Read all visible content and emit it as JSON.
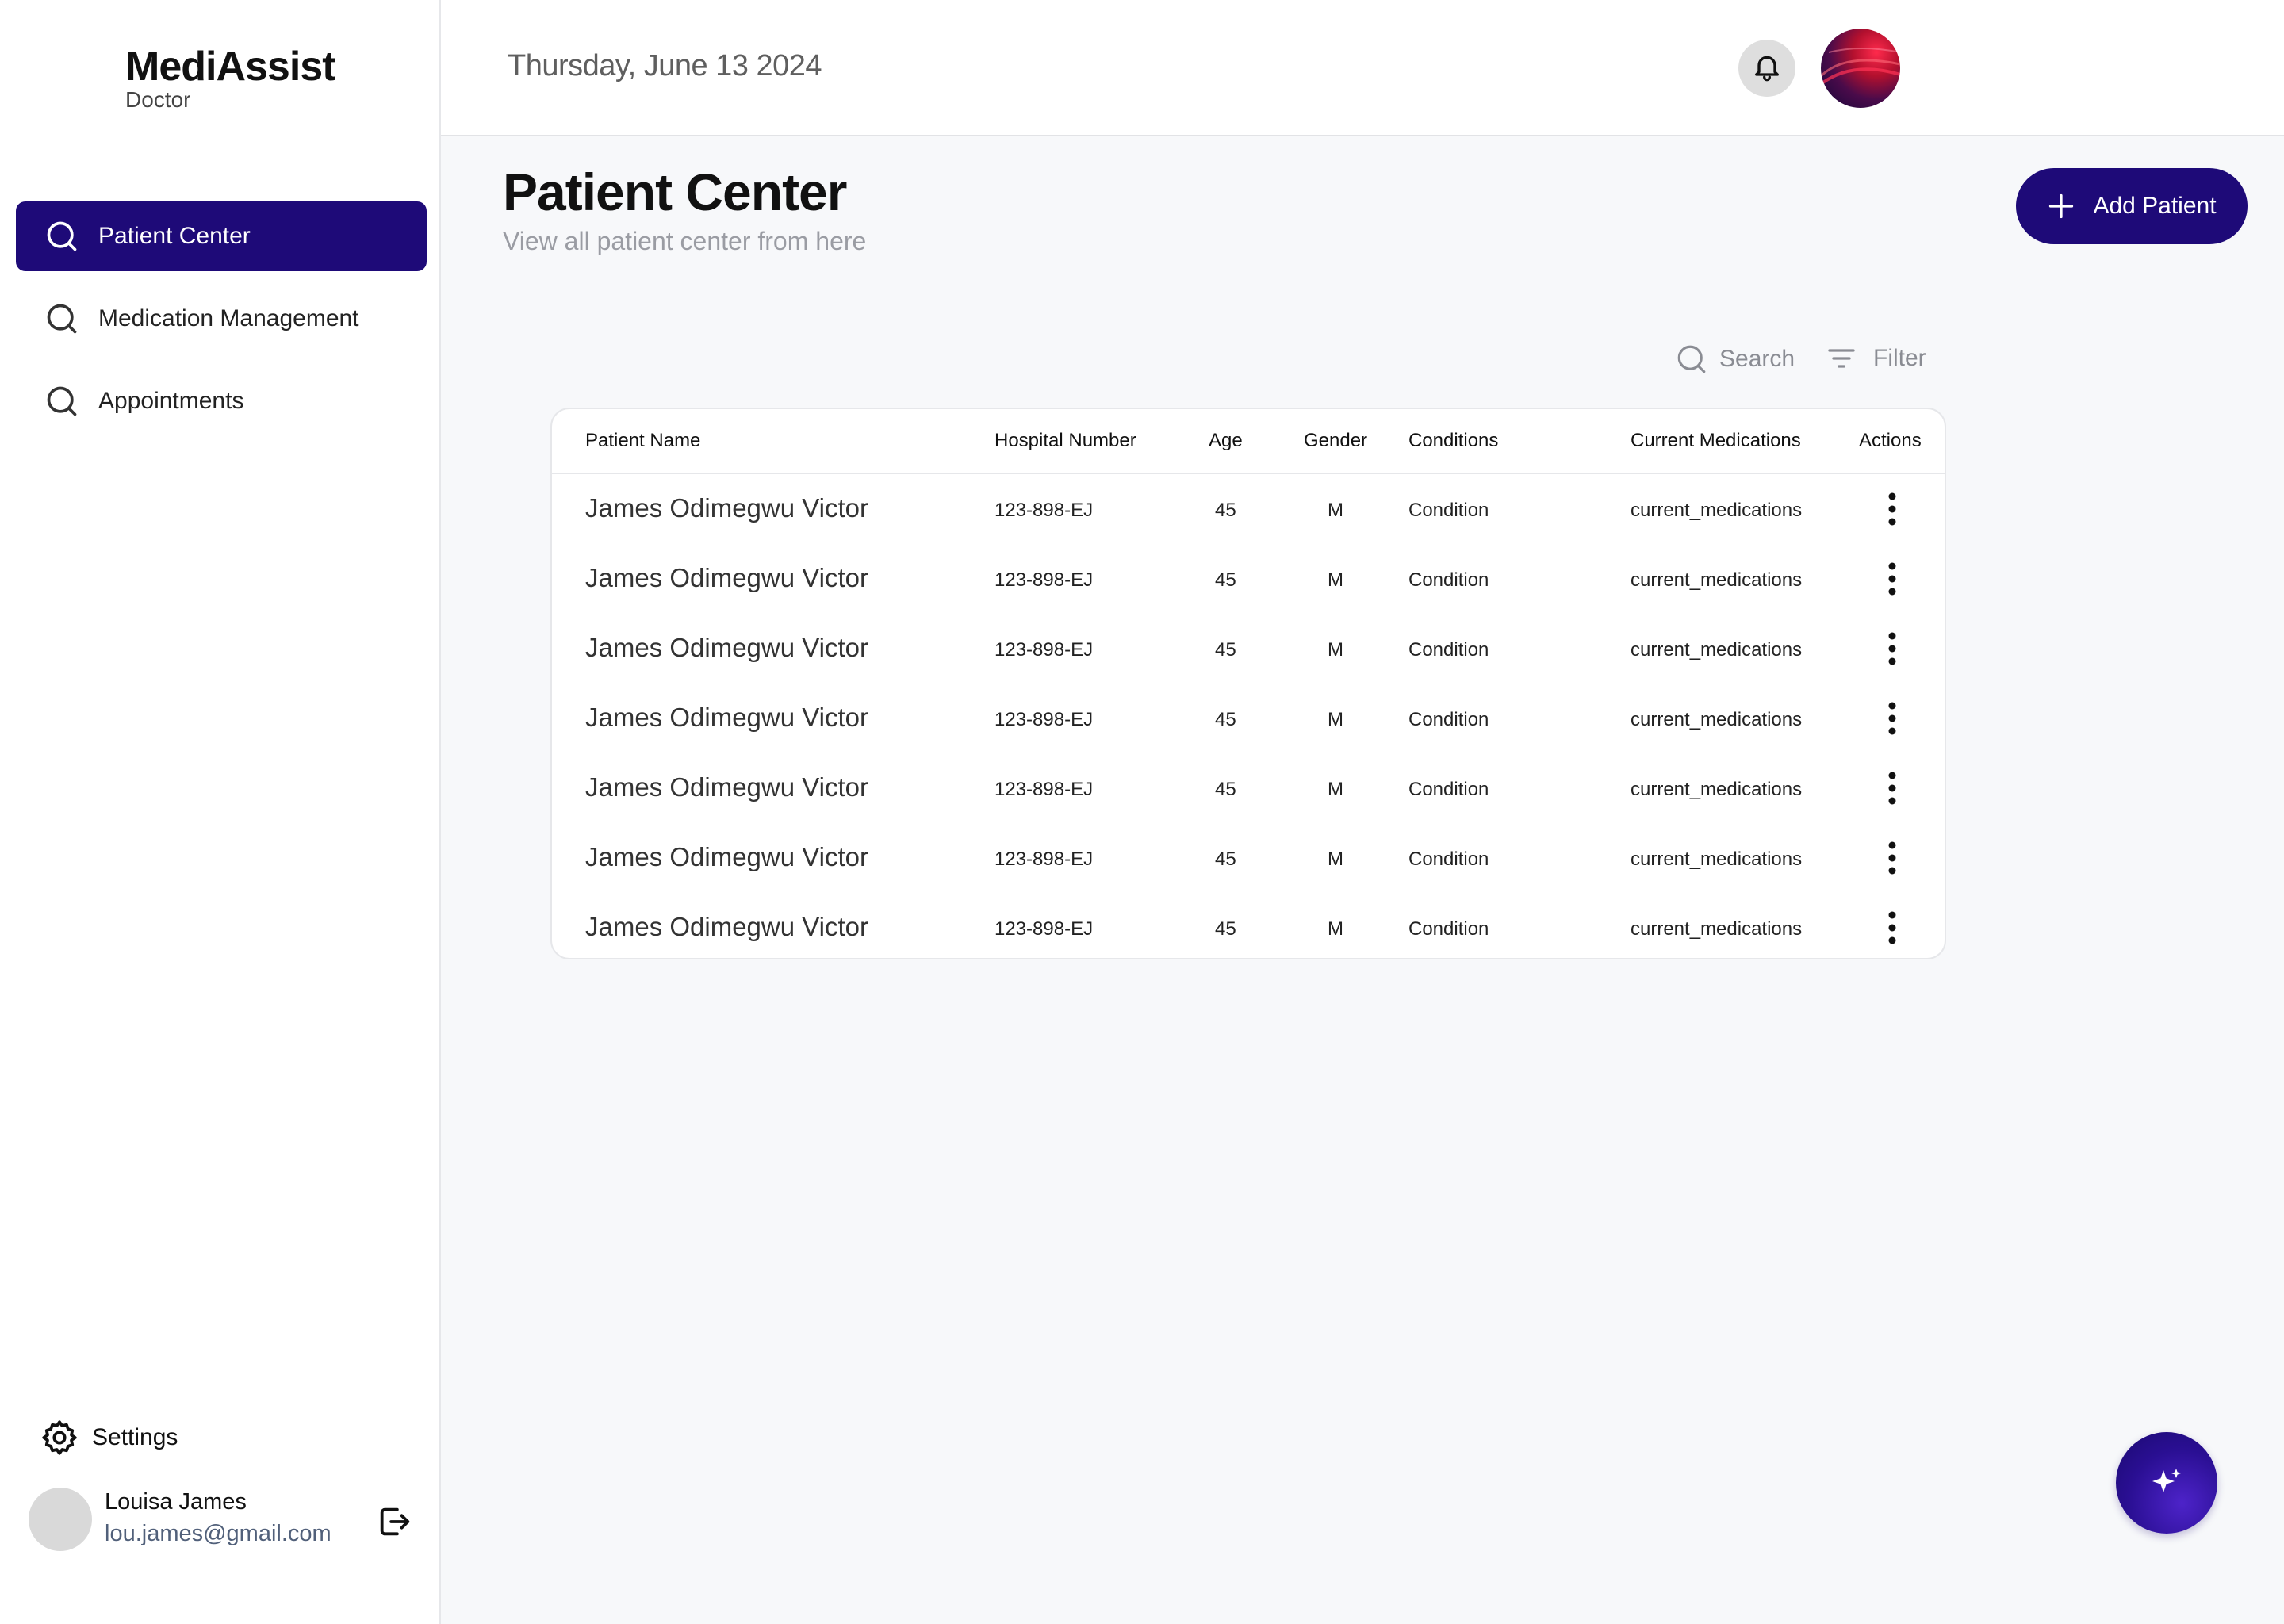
{
  "brand": {
    "name": "MediAssist",
    "role": "Doctor"
  },
  "sidebar": {
    "items": [
      {
        "label": "Patient Center",
        "active": true
      },
      {
        "label": "Medication Management",
        "active": false
      },
      {
        "label": "Appointments",
        "active": false
      }
    ],
    "settings_label": "Settings"
  },
  "user": {
    "name": "Louisa James",
    "email": "lou.james@gmail.com"
  },
  "header": {
    "date": "Thursday, June 13 2024"
  },
  "page": {
    "title": "Patient Center",
    "subtitle": "View all patient center from here",
    "add_button_label": "Add Patient"
  },
  "toolbar": {
    "search_label": "Search",
    "filter_label": "Filter"
  },
  "table": {
    "columns": [
      "Patient Name",
      "Hospital Number",
      "Age",
      "Gender",
      "Conditions",
      "Current Medications",
      "Actions"
    ],
    "rows": [
      {
        "name": "James Odimegwu Victor",
        "hospital_number": "123-898-EJ",
        "age": "45",
        "gender": "M",
        "condition": "Condition",
        "medications": "current_medications"
      },
      {
        "name": "James Odimegwu Victor",
        "hospital_number": "123-898-EJ",
        "age": "45",
        "gender": "M",
        "condition": "Condition",
        "medications": "current_medications"
      },
      {
        "name": "James Odimegwu Victor",
        "hospital_number": "123-898-EJ",
        "age": "45",
        "gender": "M",
        "condition": "Condition",
        "medications": "current_medications"
      },
      {
        "name": "James Odimegwu Victor",
        "hospital_number": "123-898-EJ",
        "age": "45",
        "gender": "M",
        "condition": "Condition",
        "medications": "current_medications"
      },
      {
        "name": "James Odimegwu Victor",
        "hospital_number": "123-898-EJ",
        "age": "45",
        "gender": "M",
        "condition": "Condition",
        "medications": "current_medications"
      },
      {
        "name": "James Odimegwu Victor",
        "hospital_number": "123-898-EJ",
        "age": "45",
        "gender": "M",
        "condition": "Condition",
        "medications": "current_medications"
      },
      {
        "name": "James Odimegwu Victor",
        "hospital_number": "123-898-EJ",
        "age": "45",
        "gender": "M",
        "condition": "Condition",
        "medications": "current_medications"
      }
    ]
  },
  "icons": {
    "nav": "search-icon",
    "settings": "gear-icon",
    "logout": "logout-icon",
    "bell": "bell-icon",
    "add": "plus-icon",
    "search": "search-icon",
    "filter": "filter-icon",
    "row_action": "more-vertical-icon",
    "assistant": "sparkle-icon"
  },
  "colors": {
    "primary": "#1e0a78",
    "background": "#f7f8fa",
    "muted_text": "#9a9ca3"
  }
}
